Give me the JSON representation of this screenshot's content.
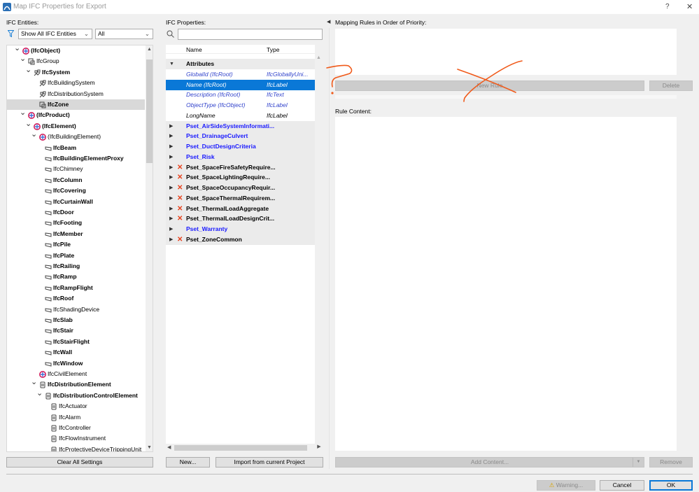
{
  "window": {
    "title": "Map IFC Properties for Export",
    "help": "?",
    "close": "✕"
  },
  "left": {
    "label": "IFC Entities:",
    "filter_select": "Show All IFC Entities",
    "scope_select": "All",
    "clear_button": "Clear All Settings",
    "tree": [
      {
        "l": 0,
        "t": "(IfcObject)",
        "b": 1,
        "e": 1,
        "k": "multi"
      },
      {
        "l": 1,
        "t": "IfcGroup",
        "b": 0,
        "e": 1,
        "k": "group"
      },
      {
        "l": 2,
        "t": "IfcSystem",
        "b": 1,
        "e": 1,
        "k": "system"
      },
      {
        "l": 3,
        "t": "IfcBuildingSystem",
        "b": 0,
        "k": "system"
      },
      {
        "l": 3,
        "t": "IfcDistributionSystem",
        "b": 0,
        "k": "system"
      },
      {
        "l": 3,
        "t": "IfcZone",
        "b": 1,
        "k": "group",
        "s": 1
      },
      {
        "l": 1,
        "t": "(IfcProduct)",
        "b": 1,
        "e": 1,
        "k": "multi"
      },
      {
        "l": 2,
        "t": "(IfcElement)",
        "b": 1,
        "e": 1,
        "k": "multi"
      },
      {
        "l": 3,
        "t": "(IfcBuildingElement)",
        "b": 0,
        "e": 1,
        "k": "multi"
      },
      {
        "l": 4,
        "t": "IfcBeam",
        "b": 1,
        "k": "el"
      },
      {
        "l": 4,
        "t": "IfcBuildingElementProxy",
        "b": 1,
        "k": "el"
      },
      {
        "l": 4,
        "t": "IfcChimney",
        "b": 0,
        "k": "el"
      },
      {
        "l": 4,
        "t": "IfcColumn",
        "b": 1,
        "k": "el"
      },
      {
        "l": 4,
        "t": "IfcCovering",
        "b": 1,
        "k": "el"
      },
      {
        "l": 4,
        "t": "IfcCurtainWall",
        "b": 1,
        "k": "el"
      },
      {
        "l": 4,
        "t": "IfcDoor",
        "b": 1,
        "k": "el"
      },
      {
        "l": 4,
        "t": "IfcFooting",
        "b": 1,
        "k": "el"
      },
      {
        "l": 4,
        "t": "IfcMember",
        "b": 1,
        "k": "el"
      },
      {
        "l": 4,
        "t": "IfcPile",
        "b": 1,
        "k": "el"
      },
      {
        "l": 4,
        "t": "IfcPlate",
        "b": 1,
        "k": "el"
      },
      {
        "l": 4,
        "t": "IfcRailing",
        "b": 1,
        "k": "el"
      },
      {
        "l": 4,
        "t": "IfcRamp",
        "b": 1,
        "k": "el"
      },
      {
        "l": 4,
        "t": "IfcRampFlight",
        "b": 1,
        "k": "el"
      },
      {
        "l": 4,
        "t": "IfcRoof",
        "b": 1,
        "k": "el"
      },
      {
        "l": 4,
        "t": "IfcShadingDevice",
        "b": 0,
        "k": "el"
      },
      {
        "l": 4,
        "t": "IfcSlab",
        "b": 1,
        "k": "el"
      },
      {
        "l": 4,
        "t": "IfcStair",
        "b": 1,
        "k": "el"
      },
      {
        "l": 4,
        "t": "IfcStairFlight",
        "b": 1,
        "k": "el"
      },
      {
        "l": 4,
        "t": "IfcWall",
        "b": 1,
        "k": "el"
      },
      {
        "l": 4,
        "t": "IfcWindow",
        "b": 1,
        "k": "el"
      },
      {
        "l": 3,
        "t": "IfcCivilElement",
        "b": 0,
        "k": "multi"
      },
      {
        "l": 3,
        "t": "IfcDistributionElement",
        "b": 1,
        "e": 1,
        "k": "dist"
      },
      {
        "l": 4,
        "t": "IfcDistributionControlElement",
        "b": 1,
        "e": 1,
        "k": "dist"
      },
      {
        "l": 5,
        "t": "IfcActuator",
        "b": 0,
        "k": "dist"
      },
      {
        "l": 5,
        "t": "IfcAlarm",
        "b": 0,
        "k": "dist"
      },
      {
        "l": 5,
        "t": "IfcController",
        "b": 0,
        "k": "dist"
      },
      {
        "l": 5,
        "t": "IfcFlowInstrument",
        "b": 0,
        "k": "dist"
      },
      {
        "l": 5,
        "t": "IfcProtectiveDeviceTrippingUnit",
        "b": 0,
        "k": "dist"
      }
    ]
  },
  "middle": {
    "label": "IFC Properties:",
    "search_placeholder": "",
    "col_name": "Name",
    "col_type": "Type",
    "new_button": "New...",
    "import_button": "Import from current Project",
    "rows": [
      {
        "g": 1,
        "n": "Attributes",
        "open": 1,
        "c": "black"
      },
      {
        "n": "GlobalId (IfcRoot)",
        "ty": "IfcGloballyUni...",
        "c": "vb"
      },
      {
        "n": "Name (IfcRoot)",
        "ty": "IfcLabel",
        "c": "vb",
        "s": 1
      },
      {
        "n": "Description (IfcRoot)",
        "ty": "IfcText",
        "c": "vb"
      },
      {
        "n": "ObjectType (IfcObject)",
        "ty": "IfcLabel",
        "c": "vb"
      },
      {
        "n": "LongName",
        "ty": "IfcLabel",
        "c": "black"
      },
      {
        "g": 1,
        "n": "Pset_AirSideSystemInformati...",
        "c": "blue"
      },
      {
        "g": 1,
        "n": "Pset_DrainageCulvert",
        "c": "blue"
      },
      {
        "g": 1,
        "n": "Pset_DuctDesignCriteria",
        "c": "blue"
      },
      {
        "g": 1,
        "n": "Pset_Risk",
        "c": "blue"
      },
      {
        "g": 1,
        "n": "Pset_SpaceFireSafetyRequire...",
        "c": "black",
        "x": 1
      },
      {
        "g": 1,
        "n": "Pset_SpaceLightingRequire...",
        "c": "black",
        "x": 1
      },
      {
        "g": 1,
        "n": "Pset_SpaceOccupancyRequir...",
        "c": "black",
        "x": 1
      },
      {
        "g": 1,
        "n": "Pset_SpaceThermalRequirem...",
        "c": "black",
        "x": 1
      },
      {
        "g": 1,
        "n": "Pset_ThermalLoadAggregate",
        "c": "black",
        "x": 1
      },
      {
        "g": 1,
        "n": "Pset_ThermalLoadDesignCrit...",
        "c": "black",
        "x": 1
      },
      {
        "g": 1,
        "n": "Pset_Warranty",
        "c": "blue"
      },
      {
        "g": 1,
        "n": "Pset_ZoneCommon",
        "c": "black",
        "x": 1
      }
    ]
  },
  "right": {
    "rules_label": "Mapping Rules in Order of Priority:",
    "new_rule": "New Rule",
    "delete": "Delete",
    "content_label": "Rule Content:",
    "add_content": "Add Content...",
    "remove": "Remove"
  },
  "footer": {
    "warning": "Warning...",
    "cancel": "Cancel",
    "ok": "OK"
  },
  "colors": {
    "accent": "#0a78d7",
    "annotation": "#f05a1a",
    "error": "#e8411c"
  }
}
